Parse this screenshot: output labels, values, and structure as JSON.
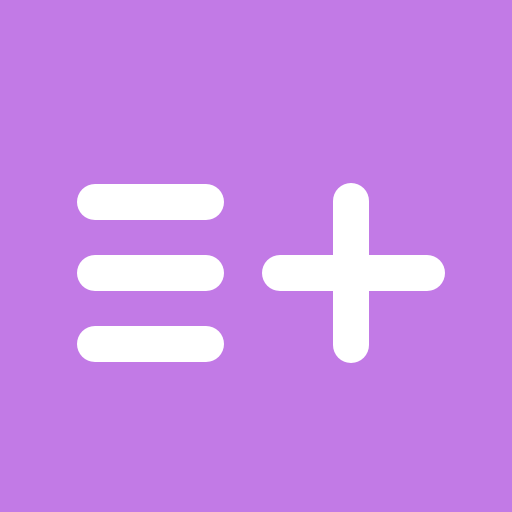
{
  "icon": {
    "name": "add-to-list-icon",
    "background_color": "#c27ae6",
    "glyph_color": "#ffffff",
    "components": [
      "list-lines",
      "plus-sign"
    ]
  }
}
